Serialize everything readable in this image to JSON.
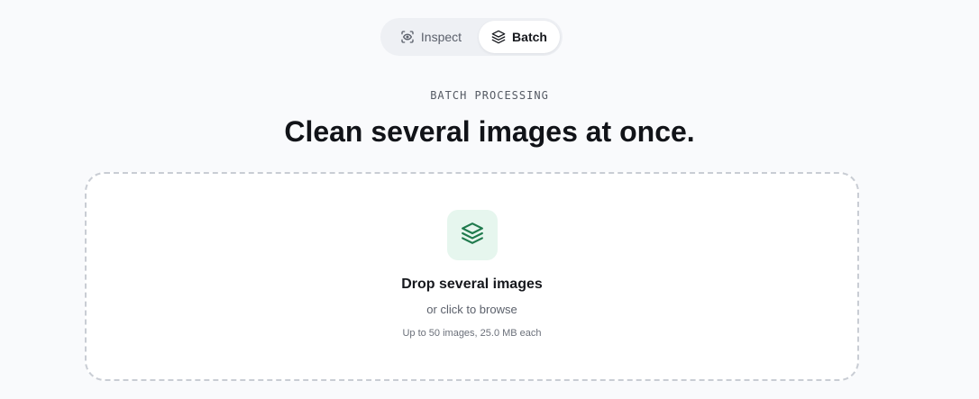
{
  "mode_switch": {
    "inspect_label": "Inspect",
    "batch_label": "Batch",
    "active": "Batch",
    "icons": {
      "inspect": "scan-eye-icon",
      "batch": "layers-icon"
    }
  },
  "header": {
    "eyebrow": "BATCH PROCESSING",
    "title": "Clean several images at once."
  },
  "dropzone": {
    "icon": "layers-icon",
    "title": "Drop several images",
    "subtitle": "or click to browse",
    "limits": "Up to 50 images, 25.0 MB each"
  },
  "colors": {
    "background": "#f9fafc",
    "accent_green": "#1f7a4d",
    "icon_tile": "#e6f6ee",
    "dashed_border": "#c9cdd4"
  }
}
